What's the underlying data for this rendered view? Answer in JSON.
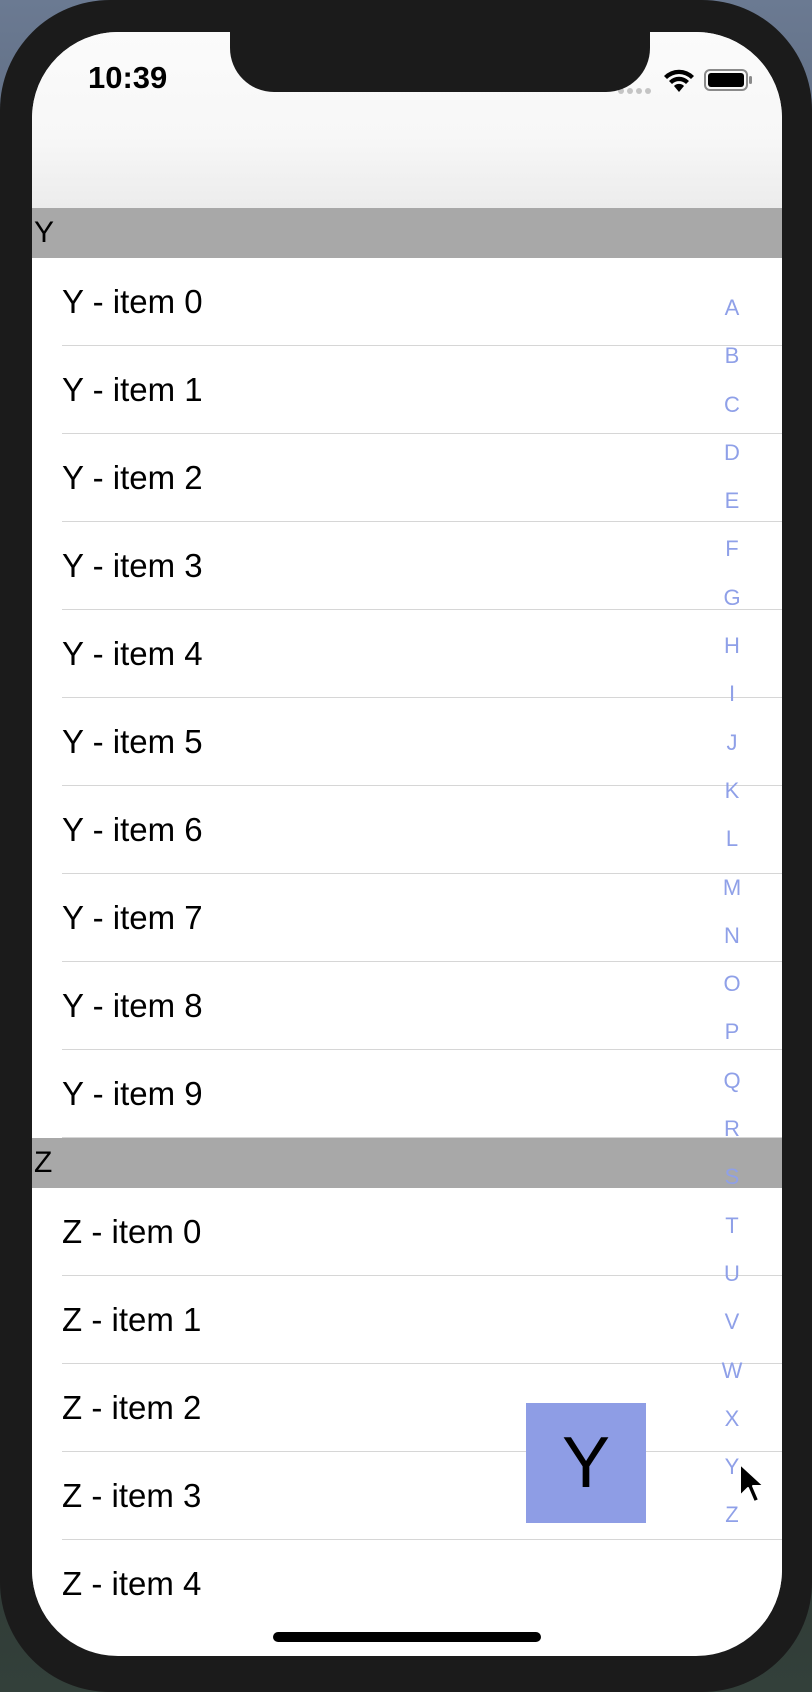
{
  "status_bar": {
    "time": "10:39"
  },
  "sections": [
    {
      "header": "Y",
      "items": [
        "Y - item 0",
        "Y - item 1",
        "Y - item 2",
        "Y - item 3",
        "Y - item 4",
        "Y - item 5",
        "Y - item 6",
        "Y - item 7",
        "Y - item 8",
        "Y - item 9"
      ]
    },
    {
      "header": "Z",
      "items": [
        "Z - item 0",
        "Z - item 1",
        "Z - item 2",
        "Z - item 3",
        "Z - item 4"
      ]
    }
  ],
  "section_index": [
    "A",
    "B",
    "C",
    "D",
    "E",
    "F",
    "G",
    "H",
    "I",
    "J",
    "K",
    "L",
    "M",
    "N",
    "O",
    "P",
    "Q",
    "R",
    "S",
    "T",
    "U",
    "V",
    "W",
    "X",
    "Y",
    "Z"
  ],
  "index_indicator": {
    "letter": "Y"
  },
  "colors": {
    "section_header_bg": "#a8a8a8",
    "index_letter": "#8fa0e8",
    "indicator_bg": "#8e9de5"
  }
}
